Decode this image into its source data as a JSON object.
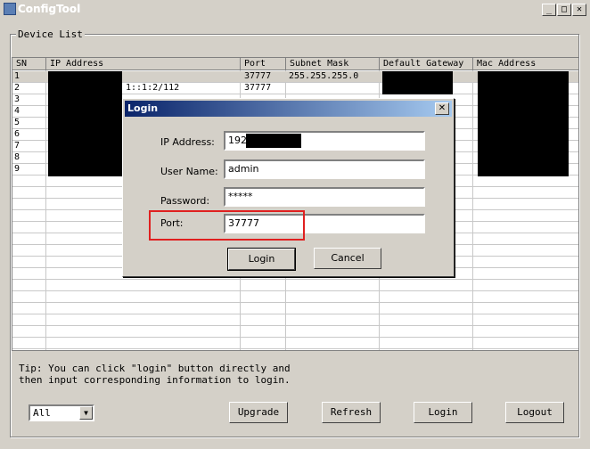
{
  "window": {
    "title": "ConfigTool",
    "min_glyph": "_",
    "max_glyph": "□",
    "close_glyph": "✕"
  },
  "device_list": {
    "label": "Device List",
    "columns": [
      "SN",
      "IP Address",
      "Port",
      "Subnet Mask",
      "Default Gateway",
      "Mac Address"
    ],
    "rows": [
      {
        "sn": "1",
        "ip": "",
        "port": "37777",
        "mask": "255.255.255.0"
      },
      {
        "sn": "2",
        "ip": "1::1:2/112",
        "port": "37777",
        "mask": ""
      },
      {
        "sn": "3",
        "ip": "",
        "port": "",
        "mask": ""
      },
      {
        "sn": "4",
        "ip": "",
        "port": "",
        "mask": ""
      },
      {
        "sn": "5",
        "ip": "",
        "port": "",
        "mask": ""
      },
      {
        "sn": "6",
        "ip": "",
        "port": "",
        "mask": ""
      },
      {
        "sn": "7",
        "ip": "",
        "port": "",
        "mask": ""
      },
      {
        "sn": "8",
        "ip": "",
        "port": "",
        "mask": ""
      },
      {
        "sn": "9",
        "ip": "",
        "port": "",
        "mask": ""
      }
    ]
  },
  "login_dialog": {
    "title": "Login",
    "ip_label": "IP Address:",
    "ip_value": "192",
    "user_label": "User Name:",
    "user_value": "admin",
    "password_label": "Password:",
    "password_value": "*****",
    "port_label": "Port:",
    "port_value": "37777",
    "login_button": "Login",
    "cancel_button": "Cancel",
    "close_glyph": "✕"
  },
  "tip": {
    "line1": "Tip: You can click \"login\" button directly and",
    "line2": "then input corresponding information to login."
  },
  "filter": {
    "selected": "All",
    "arrow": "▼"
  },
  "actions": {
    "upgrade": "Upgrade",
    "refresh": "Refresh",
    "login": "Login",
    "logout": "Logout"
  },
  "colors": {
    "highlight": "#e02020",
    "dialog_title": "#0a246a"
  }
}
